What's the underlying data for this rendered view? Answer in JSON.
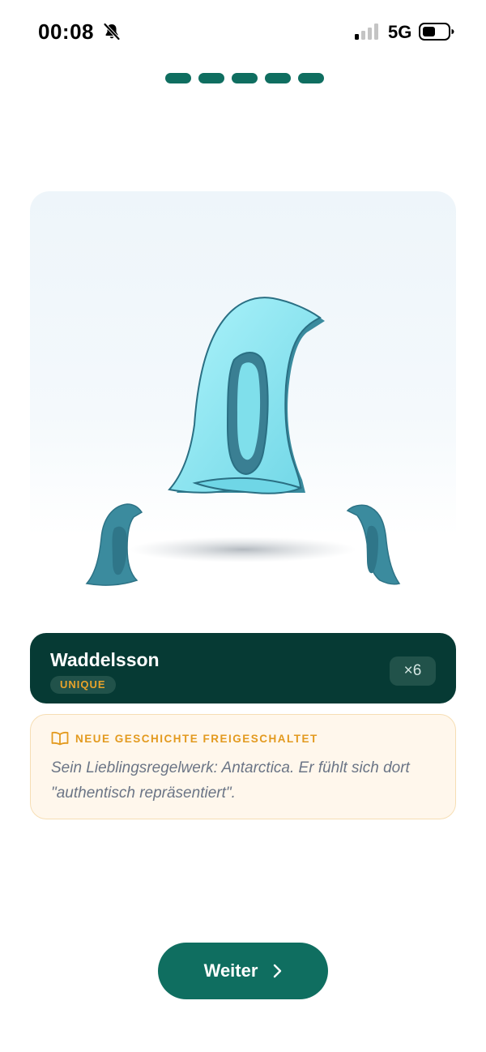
{
  "status_bar": {
    "time": "00:08",
    "network": "5G",
    "icons": [
      "bell-slash-icon",
      "signal-icon",
      "battery-icon"
    ]
  },
  "progress": {
    "segments": 5,
    "completed": 5
  },
  "illustration": {
    "subject": "penguin-icon",
    "color_main": "#8fe6f2",
    "color_shadow": "#3a8b9e"
  },
  "character": {
    "name": "Waddelsson",
    "rarity": "UNIQUE",
    "count": "×6"
  },
  "story": {
    "icon": "book-icon",
    "heading": "NEUE GESCHICHTE FREIGESCHALTET",
    "text": "Sein Lieblingsregelwerk: Antarctica. Er fühlt sich dort \"authentisch repräsentiert\"."
  },
  "actions": {
    "continue_label": "Weiter"
  },
  "colors": {
    "accent": "#0f6e60",
    "card_dark": "#063a34",
    "badge_gold": "#e8a32a",
    "story_bg": "#fff7ec"
  }
}
